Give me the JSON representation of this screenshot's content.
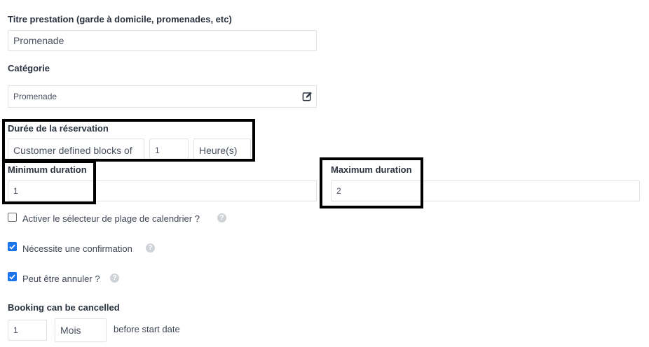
{
  "service_title": {
    "label": "Titre prestation (garde à domicile, promenades, etc)",
    "value": "Promenade"
  },
  "category": {
    "label": "Catégorie",
    "value": "Promenade",
    "edit_icon": "edit-icon"
  },
  "booking_duration": {
    "label": "Durée de la réservation",
    "mode": "Customer defined blocks of",
    "amount": "1",
    "unit": "Heure(s)"
  },
  "minimum_duration": {
    "label": "Minimum duration",
    "value": "1"
  },
  "maximum_duration": {
    "label": "Maximum duration",
    "value": "2"
  },
  "options": [
    {
      "label": "Activer le sélecteur de plage de calendrier ?",
      "checked": false,
      "help_icon": "?"
    },
    {
      "label": "Nécessite une confirmation",
      "checked": true,
      "help_icon": "?"
    },
    {
      "label": "Peut être annuler ?",
      "checked": true,
      "help_icon": "?"
    }
  ],
  "cancellation": {
    "label": "Booking can be cancelled",
    "amount": "1",
    "unit": "Mois",
    "suffix": "before start date"
  },
  "colors": {
    "accent": "#1a73e8",
    "highlight": "#000000",
    "border": "#dfe3e8"
  }
}
